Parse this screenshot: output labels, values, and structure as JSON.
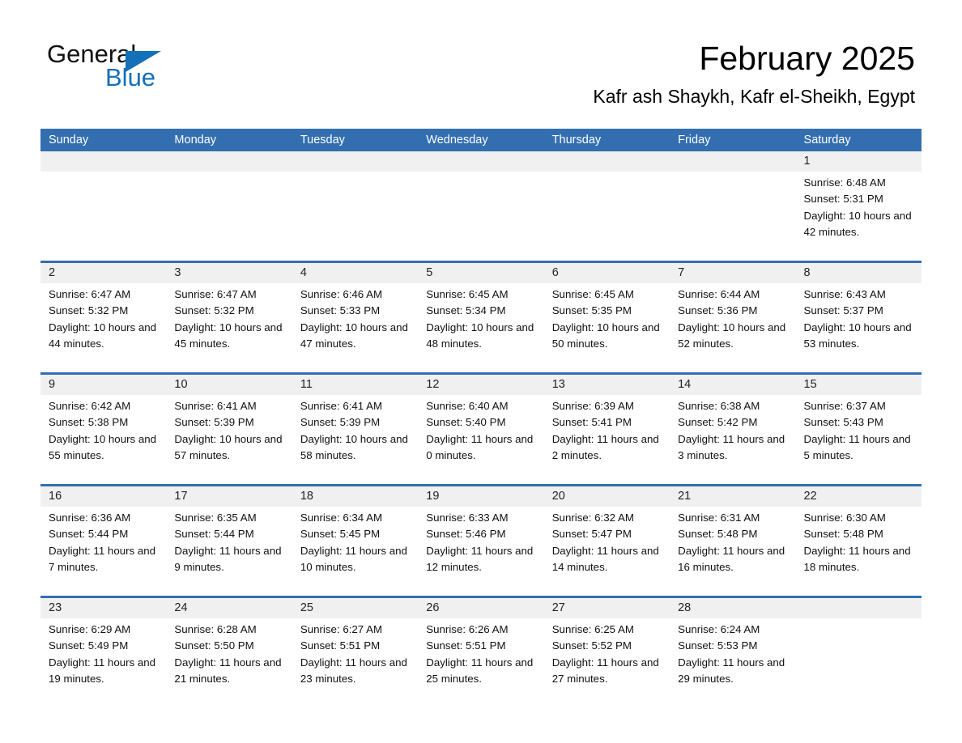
{
  "brand": {
    "name_part1": "General",
    "name_part2": "Blue",
    "accent_color": "#1470b8"
  },
  "header": {
    "month_title": "February 2025",
    "location": "Kafr ash Shaykh, Kafr el-Sheikh, Egypt"
  },
  "theme": {
    "header_blue": "#336fb0",
    "row_divider_blue": "#336fb0",
    "daynum_band": "#f0f0f0"
  },
  "weekdays": [
    "Sunday",
    "Monday",
    "Tuesday",
    "Wednesday",
    "Thursday",
    "Friday",
    "Saturday"
  ],
  "weeks": [
    [
      {
        "day": "",
        "empty": true
      },
      {
        "day": "",
        "empty": true
      },
      {
        "day": "",
        "empty": true
      },
      {
        "day": "",
        "empty": true
      },
      {
        "day": "",
        "empty": true
      },
      {
        "day": "",
        "empty": true
      },
      {
        "day": "1",
        "sunrise": "Sunrise: 6:48 AM",
        "sunset": "Sunset: 5:31 PM",
        "daylight": "Daylight: 10 hours and 42 minutes."
      }
    ],
    [
      {
        "day": "2",
        "sunrise": "Sunrise: 6:47 AM",
        "sunset": "Sunset: 5:32 PM",
        "daylight": "Daylight: 10 hours and 44 minutes."
      },
      {
        "day": "3",
        "sunrise": "Sunrise: 6:47 AM",
        "sunset": "Sunset: 5:32 PM",
        "daylight": "Daylight: 10 hours and 45 minutes."
      },
      {
        "day": "4",
        "sunrise": "Sunrise: 6:46 AM",
        "sunset": "Sunset: 5:33 PM",
        "daylight": "Daylight: 10 hours and 47 minutes."
      },
      {
        "day": "5",
        "sunrise": "Sunrise: 6:45 AM",
        "sunset": "Sunset: 5:34 PM",
        "daylight": "Daylight: 10 hours and 48 minutes."
      },
      {
        "day": "6",
        "sunrise": "Sunrise: 6:45 AM",
        "sunset": "Sunset: 5:35 PM",
        "daylight": "Daylight: 10 hours and 50 minutes."
      },
      {
        "day": "7",
        "sunrise": "Sunrise: 6:44 AM",
        "sunset": "Sunset: 5:36 PM",
        "daylight": "Daylight: 10 hours and 52 minutes."
      },
      {
        "day": "8",
        "sunrise": "Sunrise: 6:43 AM",
        "sunset": "Sunset: 5:37 PM",
        "daylight": "Daylight: 10 hours and 53 minutes."
      }
    ],
    [
      {
        "day": "9",
        "sunrise": "Sunrise: 6:42 AM",
        "sunset": "Sunset: 5:38 PM",
        "daylight": "Daylight: 10 hours and 55 minutes."
      },
      {
        "day": "10",
        "sunrise": "Sunrise: 6:41 AM",
        "sunset": "Sunset: 5:39 PM",
        "daylight": "Daylight: 10 hours and 57 minutes."
      },
      {
        "day": "11",
        "sunrise": "Sunrise: 6:41 AM",
        "sunset": "Sunset: 5:39 PM",
        "daylight": "Daylight: 10 hours and 58 minutes."
      },
      {
        "day": "12",
        "sunrise": "Sunrise: 6:40 AM",
        "sunset": "Sunset: 5:40 PM",
        "daylight": "Daylight: 11 hours and 0 minutes."
      },
      {
        "day": "13",
        "sunrise": "Sunrise: 6:39 AM",
        "sunset": "Sunset: 5:41 PM",
        "daylight": "Daylight: 11 hours and 2 minutes."
      },
      {
        "day": "14",
        "sunrise": "Sunrise: 6:38 AM",
        "sunset": "Sunset: 5:42 PM",
        "daylight": "Daylight: 11 hours and 3 minutes."
      },
      {
        "day": "15",
        "sunrise": "Sunrise: 6:37 AM",
        "sunset": "Sunset: 5:43 PM",
        "daylight": "Daylight: 11 hours and 5 minutes."
      }
    ],
    [
      {
        "day": "16",
        "sunrise": "Sunrise: 6:36 AM",
        "sunset": "Sunset: 5:44 PM",
        "daylight": "Daylight: 11 hours and 7 minutes."
      },
      {
        "day": "17",
        "sunrise": "Sunrise: 6:35 AM",
        "sunset": "Sunset: 5:44 PM",
        "daylight": "Daylight: 11 hours and 9 minutes."
      },
      {
        "day": "18",
        "sunrise": "Sunrise: 6:34 AM",
        "sunset": "Sunset: 5:45 PM",
        "daylight": "Daylight: 11 hours and 10 minutes."
      },
      {
        "day": "19",
        "sunrise": "Sunrise: 6:33 AM",
        "sunset": "Sunset: 5:46 PM",
        "daylight": "Daylight: 11 hours and 12 minutes."
      },
      {
        "day": "20",
        "sunrise": "Sunrise: 6:32 AM",
        "sunset": "Sunset: 5:47 PM",
        "daylight": "Daylight: 11 hours and 14 minutes."
      },
      {
        "day": "21",
        "sunrise": "Sunrise: 6:31 AM",
        "sunset": "Sunset: 5:48 PM",
        "daylight": "Daylight: 11 hours and 16 minutes."
      },
      {
        "day": "22",
        "sunrise": "Sunrise: 6:30 AM",
        "sunset": "Sunset: 5:48 PM",
        "daylight": "Daylight: 11 hours and 18 minutes."
      }
    ],
    [
      {
        "day": "23",
        "sunrise": "Sunrise: 6:29 AM",
        "sunset": "Sunset: 5:49 PM",
        "daylight": "Daylight: 11 hours and 19 minutes."
      },
      {
        "day": "24",
        "sunrise": "Sunrise: 6:28 AM",
        "sunset": "Sunset: 5:50 PM",
        "daylight": "Daylight: 11 hours and 21 minutes."
      },
      {
        "day": "25",
        "sunrise": "Sunrise: 6:27 AM",
        "sunset": "Sunset: 5:51 PM",
        "daylight": "Daylight: 11 hours and 23 minutes."
      },
      {
        "day": "26",
        "sunrise": "Sunrise: 6:26 AM",
        "sunset": "Sunset: 5:51 PM",
        "daylight": "Daylight: 11 hours and 25 minutes."
      },
      {
        "day": "27",
        "sunrise": "Sunrise: 6:25 AM",
        "sunset": "Sunset: 5:52 PM",
        "daylight": "Daylight: 11 hours and 27 minutes."
      },
      {
        "day": "28",
        "sunrise": "Sunrise: 6:24 AM",
        "sunset": "Sunset: 5:53 PM",
        "daylight": "Daylight: 11 hours and 29 minutes."
      },
      {
        "day": "",
        "empty": true
      }
    ]
  ]
}
